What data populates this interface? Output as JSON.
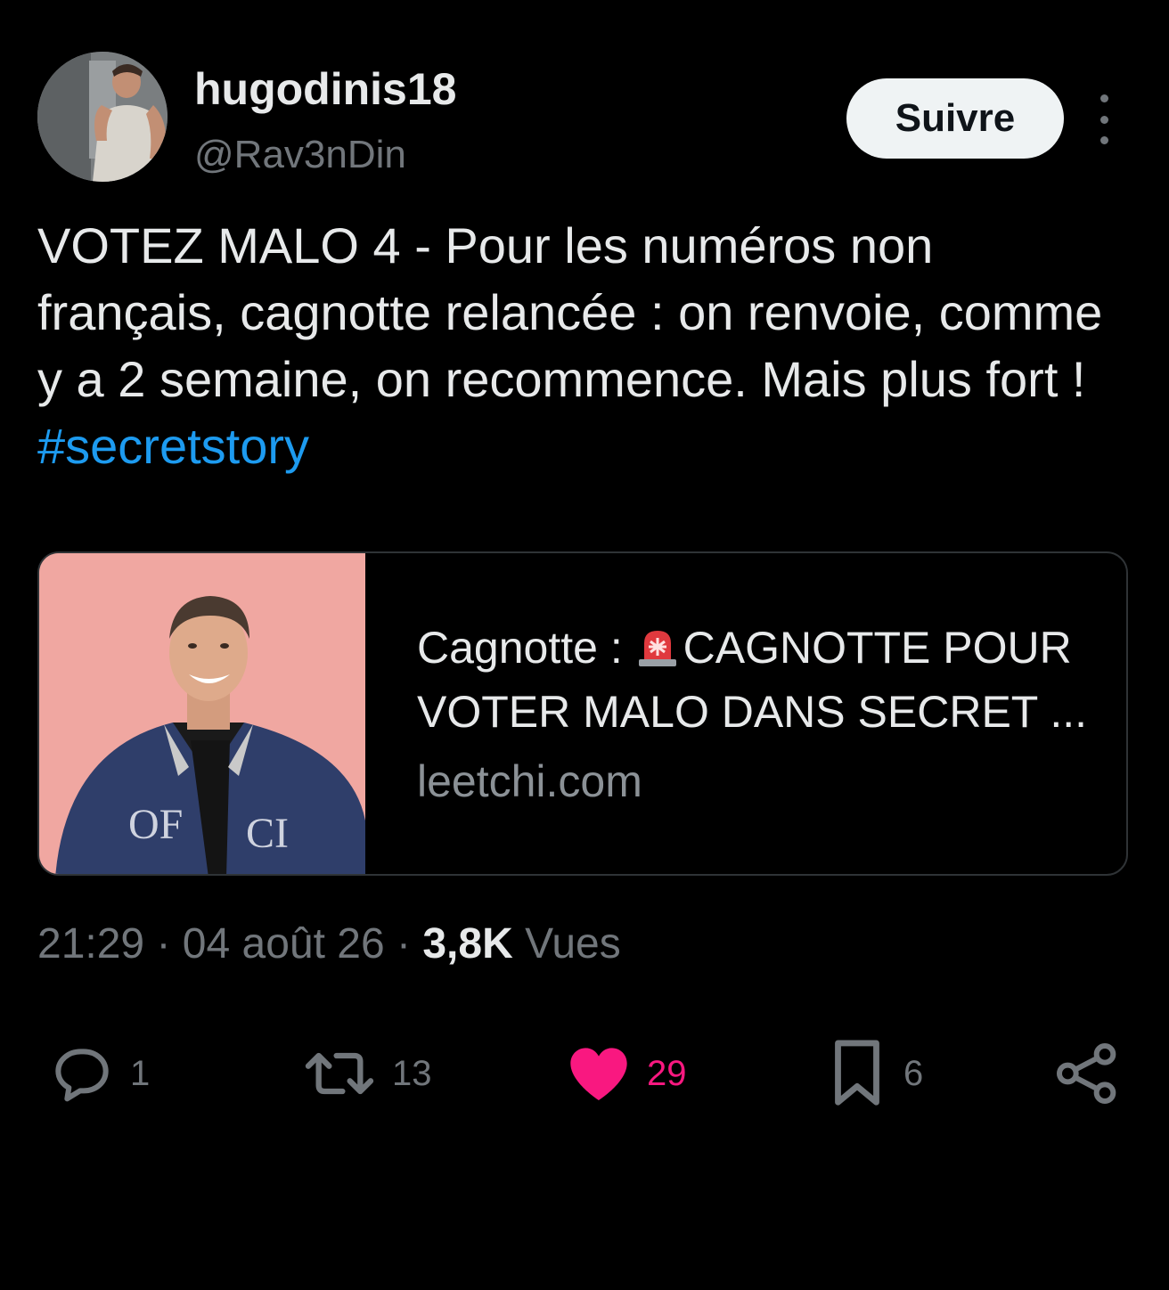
{
  "user": {
    "display_name": "hugodinis18",
    "handle": "@Rav3nDin",
    "follow_label": "Suivre"
  },
  "tweet": {
    "text": "VOTEZ MALO 4 - Pour les numéros non français, cagnotte relancée : on renvoie, comme y a 2 semaine, on recommence. Mais plus fort ! ",
    "hashtag": "#secretstory"
  },
  "card": {
    "title_prefix": "Cagnotte : ",
    "title_rest": "CAGNOTTE POUR VOTER MALO DANS SECRET ...",
    "domain": "leetchi.com",
    "jacket_text": "OF · CI"
  },
  "meta": {
    "time": "21:29",
    "date": "04 août 26",
    "views_count": "3,8K",
    "views_label": "Vues",
    "sep": "·"
  },
  "actions": {
    "replies": "1",
    "retweets": "13",
    "likes": "29",
    "bookmarks": "6"
  },
  "colors": {
    "background": "#000000",
    "hashtag": "#1d9bf0",
    "like": "#f91880",
    "muted": "#71767b"
  }
}
